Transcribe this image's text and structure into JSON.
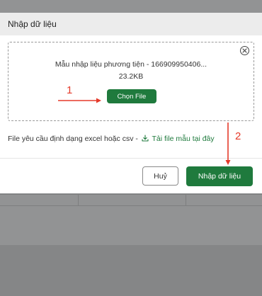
{
  "modal": {
    "title": "Nhập dữ liệu",
    "file_name": "Mẫu nhập liệu phương tiện - 166909950406...",
    "file_size": "23.2KB",
    "choose_file_label": "Chọn File",
    "hint_text": "File yêu cầu định dạng excel hoặc csv -",
    "template_link": "Tải file mẫu tại đây",
    "cancel_label": "Huỷ",
    "import_label": "Nhập dữ liệu"
  },
  "annotations": {
    "step1": "1",
    "step2": "2"
  },
  "colors": {
    "primary": "#1f7a3d",
    "annotation": "#e53a2a",
    "overlay": "#929394"
  },
  "icons": {
    "close": "close-circle-icon",
    "download": "download-icon"
  }
}
